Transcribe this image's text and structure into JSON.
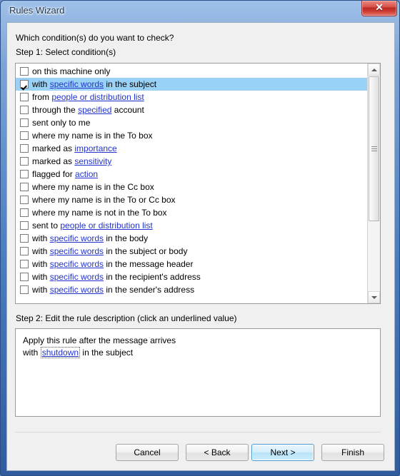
{
  "window": {
    "title": "Rules Wizard",
    "close_label": "✕",
    "accent_color": "#4a7cbe",
    "close_color": "#b92a23"
  },
  "body": {
    "question": "Which condition(s) do you want to check?",
    "step1_label": "Step 1: Select condition(s)",
    "step2_label": "Step 2: Edit the rule description (click an underlined value)"
  },
  "conditions": [
    {
      "checked": false,
      "parts": [
        {
          "text": "on this machine only",
          "link": false
        }
      ]
    },
    {
      "checked": true,
      "parts": [
        {
          "text": "with ",
          "link": false
        },
        {
          "text": "specific words",
          "link": true
        },
        {
          "text": " in the subject",
          "link": false
        }
      ]
    },
    {
      "checked": false,
      "parts": [
        {
          "text": "from ",
          "link": false
        },
        {
          "text": "people or distribution list",
          "link": true
        }
      ]
    },
    {
      "checked": false,
      "parts": [
        {
          "text": "through the ",
          "link": false
        },
        {
          "text": "specified",
          "link": true
        },
        {
          "text": " account",
          "link": false
        }
      ]
    },
    {
      "checked": false,
      "parts": [
        {
          "text": "sent only to me",
          "link": false
        }
      ]
    },
    {
      "checked": false,
      "parts": [
        {
          "text": "where my name is in the To box",
          "link": false
        }
      ]
    },
    {
      "checked": false,
      "parts": [
        {
          "text": "marked as ",
          "link": false
        },
        {
          "text": "importance",
          "link": true
        }
      ]
    },
    {
      "checked": false,
      "parts": [
        {
          "text": "marked as ",
          "link": false
        },
        {
          "text": "sensitivity",
          "link": true
        }
      ]
    },
    {
      "checked": false,
      "parts": [
        {
          "text": "flagged for ",
          "link": false
        },
        {
          "text": "action",
          "link": true
        }
      ]
    },
    {
      "checked": false,
      "parts": [
        {
          "text": "where my name is in the Cc box",
          "link": false
        }
      ]
    },
    {
      "checked": false,
      "parts": [
        {
          "text": "where my name is in the To or Cc box",
          "link": false
        }
      ]
    },
    {
      "checked": false,
      "parts": [
        {
          "text": "where my name is not in the To box",
          "link": false
        }
      ]
    },
    {
      "checked": false,
      "parts": [
        {
          "text": "sent to ",
          "link": false
        },
        {
          "text": "people or distribution list",
          "link": true
        }
      ]
    },
    {
      "checked": false,
      "parts": [
        {
          "text": "with ",
          "link": false
        },
        {
          "text": "specific words",
          "link": true
        },
        {
          "text": " in the body",
          "link": false
        }
      ]
    },
    {
      "checked": false,
      "parts": [
        {
          "text": "with ",
          "link": false
        },
        {
          "text": "specific words",
          "link": true
        },
        {
          "text": " in the subject or body",
          "link": false
        }
      ]
    },
    {
      "checked": false,
      "parts": [
        {
          "text": "with ",
          "link": false
        },
        {
          "text": "specific words",
          "link": true
        },
        {
          "text": " in the message header",
          "link": false
        }
      ]
    },
    {
      "checked": false,
      "parts": [
        {
          "text": "with ",
          "link": false
        },
        {
          "text": "specific words",
          "link": true
        },
        {
          "text": " in the recipient's address",
          "link": false
        }
      ]
    },
    {
      "checked": false,
      "parts": [
        {
          "text": "with ",
          "link": false
        },
        {
          "text": "specific words",
          "link": true
        },
        {
          "text": " in the sender's address",
          "link": false
        }
      ]
    }
  ],
  "scrollbar": {
    "up_arrow": "scroll-up-arrow",
    "down_arrow": "scroll-down-arrow",
    "thumb_position": "top"
  },
  "description": {
    "line1": "Apply this rule after the message arrives",
    "line2_prefix": "with ",
    "line2_link": "shutdown",
    "line2_suffix": " in the subject"
  },
  "buttons": {
    "cancel": "Cancel",
    "back": "< Back",
    "next": "Next >",
    "finish": "Finish"
  }
}
